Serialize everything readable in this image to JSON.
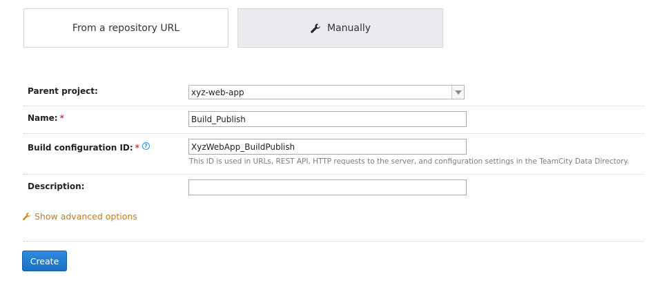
{
  "tabs": {
    "repository_url": {
      "label": "From a repository URL"
    },
    "manually": {
      "label": "Manually",
      "icon": "wrench-icon",
      "selected": true
    }
  },
  "form": {
    "parent_project": {
      "label": "Parent project:",
      "value": "xyz-web-app"
    },
    "name": {
      "label": "Name:",
      "required_mark": "*",
      "value": "Build_Publish"
    },
    "build_config_id": {
      "label": "Build configuration ID:",
      "required_mark": "*",
      "help_icon": "help-icon",
      "value": "XyzWebApp_BuildPublish",
      "hint": "This ID is used in URLs, REST API, HTTP requests to the server, and configuration settings in the TeamCity Data Directory."
    },
    "description": {
      "label": "Description:",
      "value": ""
    }
  },
  "advanced": {
    "label": "Show advanced options",
    "icon": "wrench-icon",
    "color": "#c07f1c"
  },
  "actions": {
    "create_label": "Create",
    "color": "#1f78cc"
  }
}
